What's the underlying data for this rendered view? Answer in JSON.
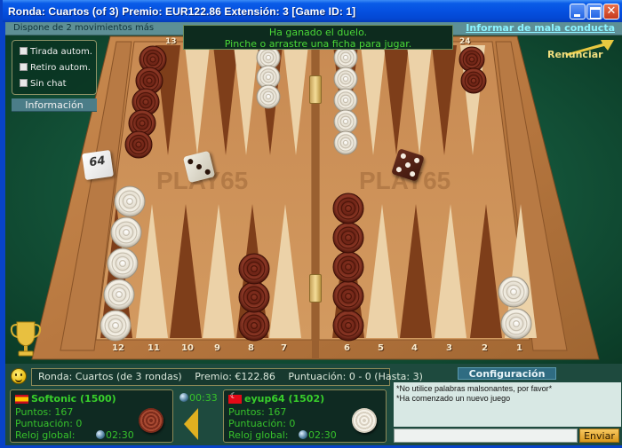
{
  "window": {
    "title": "Ronda: Cuartos (of 3)   Premio: EUR122.86   Extensión: 3   [Game ID: 1]",
    "close_glyph": "✕"
  },
  "status": {
    "moves_left": "Dispone de  2 movimientos más",
    "report_link": "Informar de mala conducta"
  },
  "message": {
    "line1": "Ha ganado el duelo.",
    "line2": "Pinche o arrastre una ficha para jugar."
  },
  "options": {
    "items": [
      {
        "label": "Tirada autom.",
        "checked": false
      },
      {
        "label": "Retiro autom.",
        "checked": false
      },
      {
        "label": "Sin chat",
        "checked": false
      }
    ],
    "info_button": "Información"
  },
  "resign_label": "Renunciar",
  "board": {
    "top_point_labels": {
      "left": "13",
      "right": "24"
    },
    "bottom_point_labels": [
      "12",
      "11",
      "10",
      "9",
      "8",
      "7",
      "6",
      "5",
      "4",
      "3",
      "2",
      "1"
    ],
    "doubling_cube": "64",
    "dice": {
      "white": 3,
      "dark": 5
    },
    "checkers": [
      {
        "point": 13,
        "color": "dark",
        "count": 5
      },
      {
        "point": 17,
        "color": "light",
        "count": 3
      },
      {
        "point": 19,
        "color": "light",
        "count": 5
      },
      {
        "point": 24,
        "color": "dark",
        "count": 2
      },
      {
        "point": 12,
        "color": "light",
        "count": 5
      },
      {
        "point": 8,
        "color": "dark",
        "count": 3
      },
      {
        "point": 6,
        "color": "dark",
        "count": 5
      },
      {
        "point": 1,
        "color": "light",
        "count": 2
      }
    ],
    "watermark": "PLAY65"
  },
  "round_info": {
    "round": "Ronda: Cuartos (de 3 rondas)",
    "prize": "Premio: €122.86",
    "score": "Puntuación: 0 - 0 (Hasta: 3)"
  },
  "players": [
    {
      "name": "Softonic (1500)",
      "flag": "es",
      "points": "Puntos: 167",
      "score": "Puntuación: 0",
      "clock_label": "Reloj global:",
      "clock": "02:30",
      "piece": "dark"
    },
    {
      "name": "eyup64 (1502)",
      "flag": "tr",
      "points": "Puntos: 167",
      "score": "Puntuación: 0",
      "clock_label": "Reloj global:",
      "clock": "02:30",
      "piece": "light"
    }
  ],
  "turn": {
    "timer": "00:33",
    "active_player": "Softonic"
  },
  "chat": {
    "config_button": "Configuración",
    "messages": [
      "*No utilice palabras malsonantes, por favor*",
      "*Ha comenzado un nuevo juego"
    ],
    "input_value": "",
    "send_button": "Enviar"
  }
}
